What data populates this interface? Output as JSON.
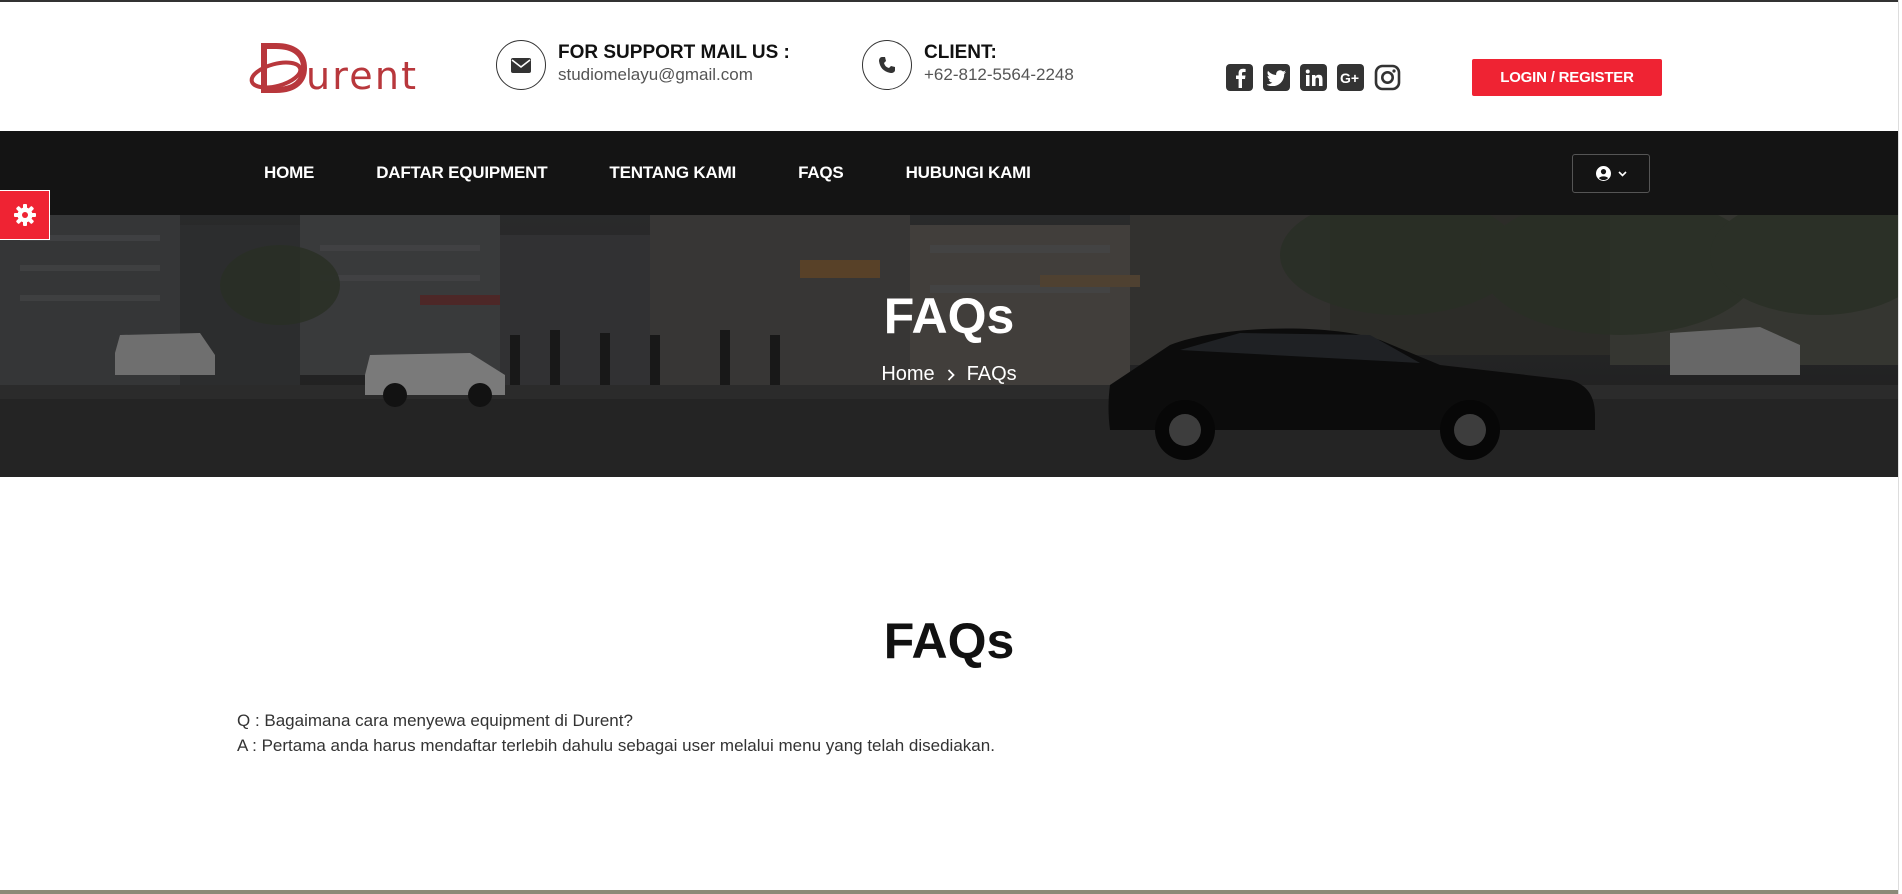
{
  "brand": {
    "logo_text": "Durent",
    "accent": "#ef2333",
    "logo_color": "#b8373c",
    "nav_bg": "#141414"
  },
  "header": {
    "mail": {
      "icon": "envelope-icon",
      "title": "FOR SUPPORT MAIL US :",
      "value": "studiomelayu@gmail.com"
    },
    "phone": {
      "icon": "phone-icon",
      "title": "CLIENT:",
      "value": "+62-812-5564-2248"
    },
    "socials": [
      "facebook-icon",
      "twitter-icon",
      "linkedin-icon",
      "google-plus-icon",
      "instagram-icon"
    ],
    "login_label": "LOGIN / REGISTER"
  },
  "nav": {
    "items": [
      "HOME",
      "DAFTAR EQUIPMENT",
      "TENTANG KAMI",
      "FAQS",
      "HUBUNGI KAMI"
    ],
    "user_dropdown_icon": "user-circle-icon"
  },
  "hero": {
    "title": "FAQs",
    "breadcrumb": {
      "home": "Home",
      "current": "FAQs"
    }
  },
  "content": {
    "heading": "FAQs",
    "faqs": [
      {
        "q": "Q : Bagaimana cara menyewa equipment di  Durent?",
        "a": "A : Pertama anda harus mendaftar terlebih dahulu sebagai user melalui menu yang telah disediakan."
      }
    ]
  }
}
